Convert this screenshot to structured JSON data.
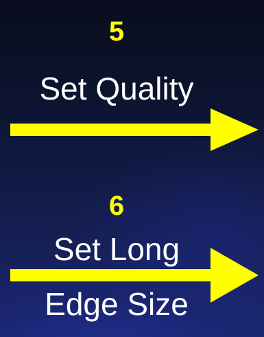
{
  "steps": [
    {
      "number": "5",
      "label_lines": [
        "Set Quality"
      ]
    },
    {
      "number": "6",
      "label_lines": [
        "Set Long",
        "Edge Size"
      ]
    }
  ],
  "colors": {
    "number": "#ffff00",
    "label": "#ffffff",
    "arrow": "#ffff00",
    "background": "#0d1430"
  },
  "icons": {
    "arrow": "arrow-right-icon"
  }
}
